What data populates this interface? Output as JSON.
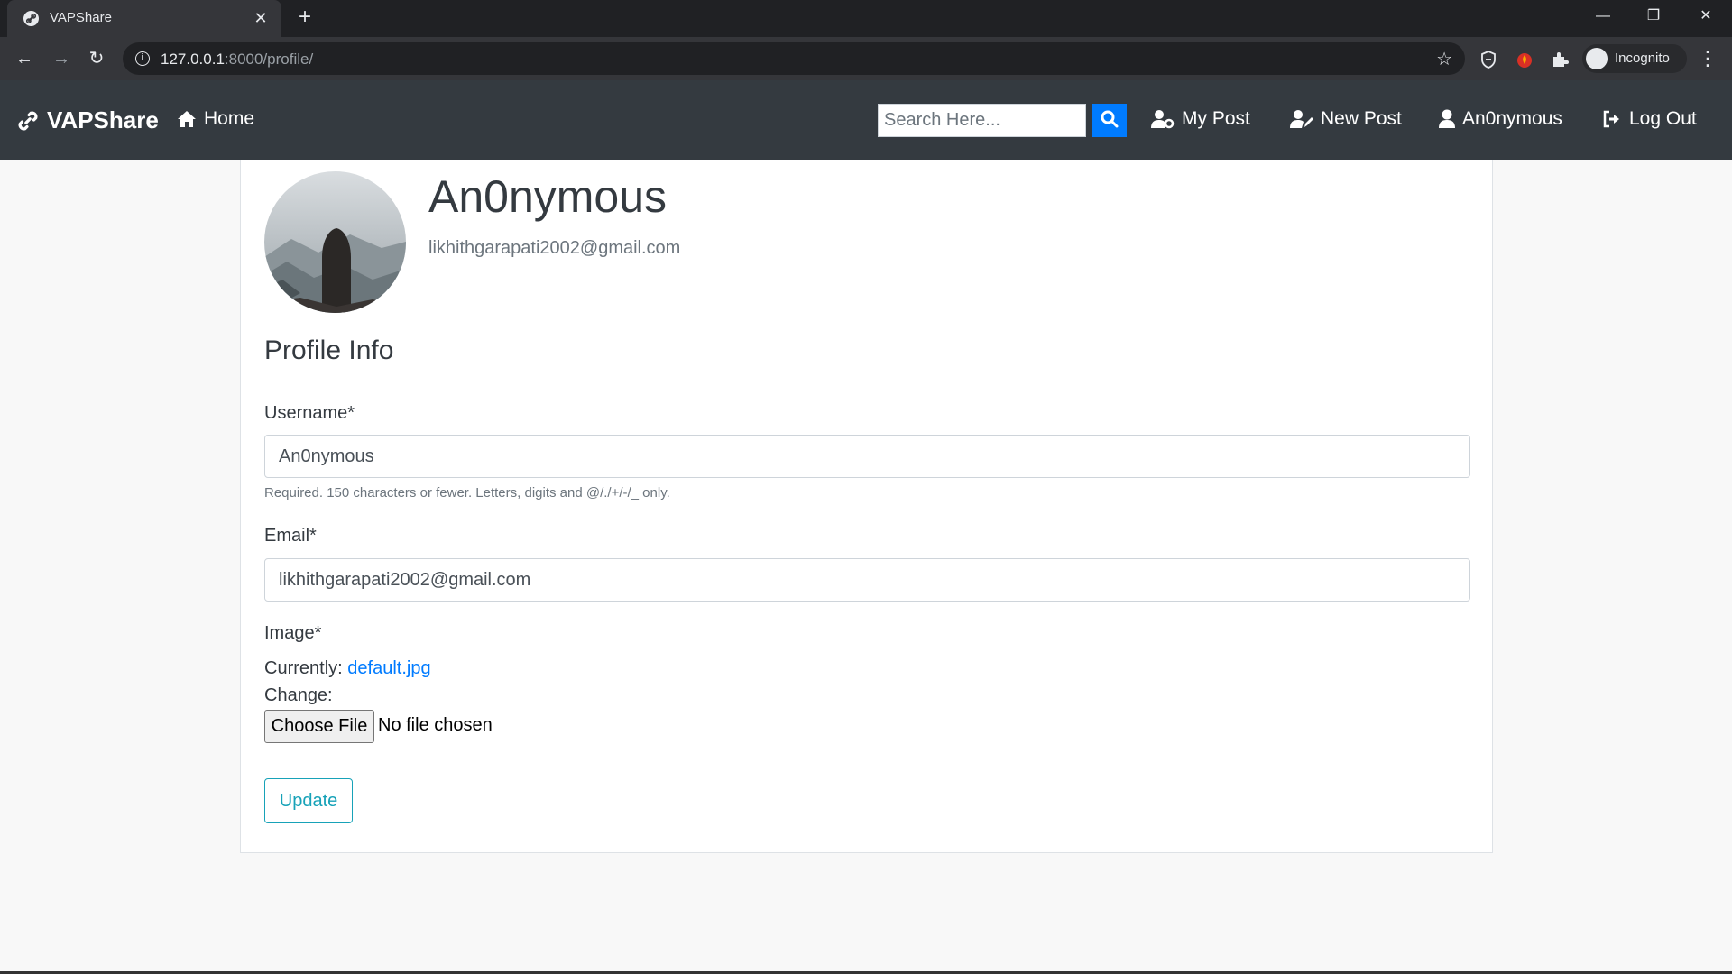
{
  "browser": {
    "tab_title": "VAPShare",
    "url_host": "127.0.0.1",
    "url_path": ":8000/profile/",
    "profile_label": "Incognito"
  },
  "site": {
    "brand": "VAPShare",
    "nav": {
      "home": "Home",
      "search_placeholder": "Search Here...",
      "my_post": "My Post",
      "new_post": "New Post",
      "user": "An0nymous",
      "logout": "Log Out"
    }
  },
  "profile": {
    "name": "An0nymous",
    "email": "likhithgarapati2002@gmail.com"
  },
  "form": {
    "legend": "Profile Info",
    "username_label": "Username*",
    "username_value": "An0nymous",
    "username_help": "Required. 150 characters or fewer. Letters, digits and @/./+/-/_ only.",
    "email_label": "Email*",
    "email_value": "likhithgarapati2002@gmail.com",
    "image_label": "Image*",
    "currently_label": "Currently:",
    "current_file": "default.jpg",
    "change_label": "Change:",
    "choose_file": "Choose File",
    "file_status": "No file chosen",
    "submit": "Update"
  },
  "colors": {
    "navbar": "#343a40",
    "primary": "#007bff",
    "info": "#17a2b8"
  }
}
